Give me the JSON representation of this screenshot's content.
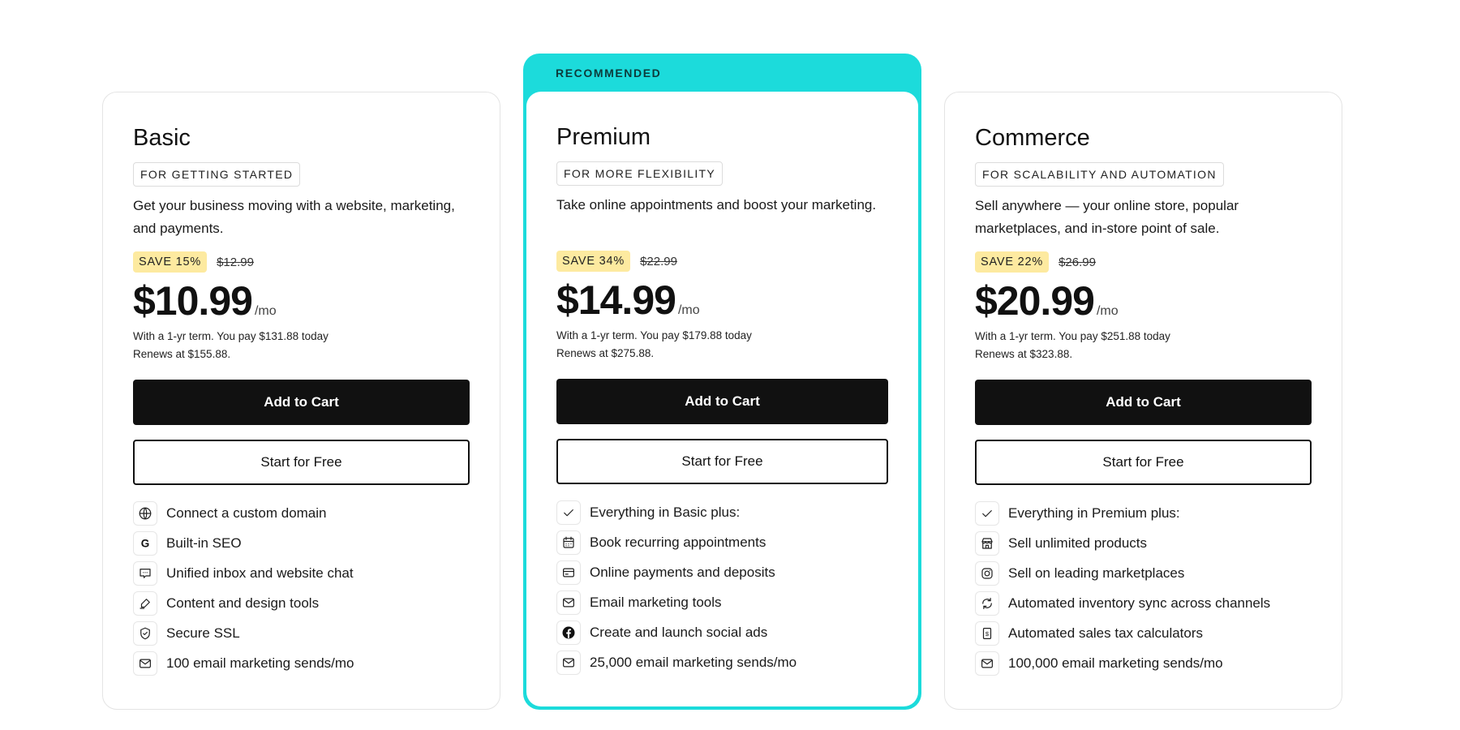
{
  "recommended_label": "RECOMMENDED",
  "plans": [
    {
      "name": "Basic",
      "tag": "FOR GETTING STARTED",
      "description": "Get your business moving with a website, marketing, and payments.",
      "save_badge": "SAVE 15%",
      "old_price": "$12.99",
      "price": "$10.99",
      "per": "/mo",
      "term_line1": "With a 1-yr term. You pay $131.88 today",
      "term_line2": "Renews at $155.88.",
      "add_to_cart": "Add to Cart",
      "start_free": "Start for Free",
      "features": [
        {
          "icon": "globe-icon",
          "text": "Connect a custom domain"
        },
        {
          "icon": "google-icon",
          "text": "Built-in SEO"
        },
        {
          "icon": "chat-icon",
          "text": "Unified inbox and website chat"
        },
        {
          "icon": "pen-icon",
          "text": "Content and design tools"
        },
        {
          "icon": "shield-check-icon",
          "text": "Secure SSL"
        },
        {
          "icon": "mail-icon",
          "text": "100 email marketing sends/mo"
        }
      ]
    },
    {
      "name": "Premium",
      "tag": "FOR MORE FLEXIBILITY",
      "description": "Take online appointments and boost your marketing.",
      "save_badge": "SAVE 34%",
      "old_price": "$22.99",
      "price": "$14.99",
      "per": "/mo",
      "term_line1": "With a 1-yr term. You pay $179.88 today",
      "term_line2": "Renews at $275.88.",
      "add_to_cart": "Add to Cart",
      "start_free": "Start for Free",
      "features": [
        {
          "icon": "check-icon",
          "text": "Everything in Basic plus:"
        },
        {
          "icon": "calendar-icon",
          "text": "Book recurring appointments"
        },
        {
          "icon": "credit-card-icon",
          "text": "Online payments and deposits"
        },
        {
          "icon": "mail-icon",
          "text": "Email marketing tools"
        },
        {
          "icon": "facebook-icon",
          "text": "Create and launch social ads"
        },
        {
          "icon": "mail-icon",
          "text": "25,000 email marketing sends/mo"
        }
      ]
    },
    {
      "name": "Commerce",
      "tag": "FOR SCALABILITY AND AUTOMATION",
      "description": "Sell anywhere — your online store, popular marketplaces, and in-store point of sale.",
      "save_badge": "SAVE 22%",
      "old_price": "$26.99",
      "price": "$20.99",
      "per": "/mo",
      "term_line1": "With a 1-yr term. You pay $251.88 today",
      "term_line2": "Renews at $323.88.",
      "add_to_cart": "Add to Cart",
      "start_free": "Start for Free",
      "features": [
        {
          "icon": "check-icon",
          "text": "Everything in Premium plus:"
        },
        {
          "icon": "storefront-icon",
          "text": "Sell unlimited products"
        },
        {
          "icon": "instagram-icon",
          "text": "Sell on leading marketplaces"
        },
        {
          "icon": "sync-icon",
          "text": "Automated inventory sync across channels"
        },
        {
          "icon": "tax-receipt-icon",
          "text": "Automated sales tax calculators"
        },
        {
          "icon": "mail-icon",
          "text": "100,000 email marketing sends/mo"
        }
      ]
    }
  ],
  "colors": {
    "accent": "#1cdbdb",
    "save_badge_bg": "#fdeaa0",
    "primary_button": "#111111"
  }
}
